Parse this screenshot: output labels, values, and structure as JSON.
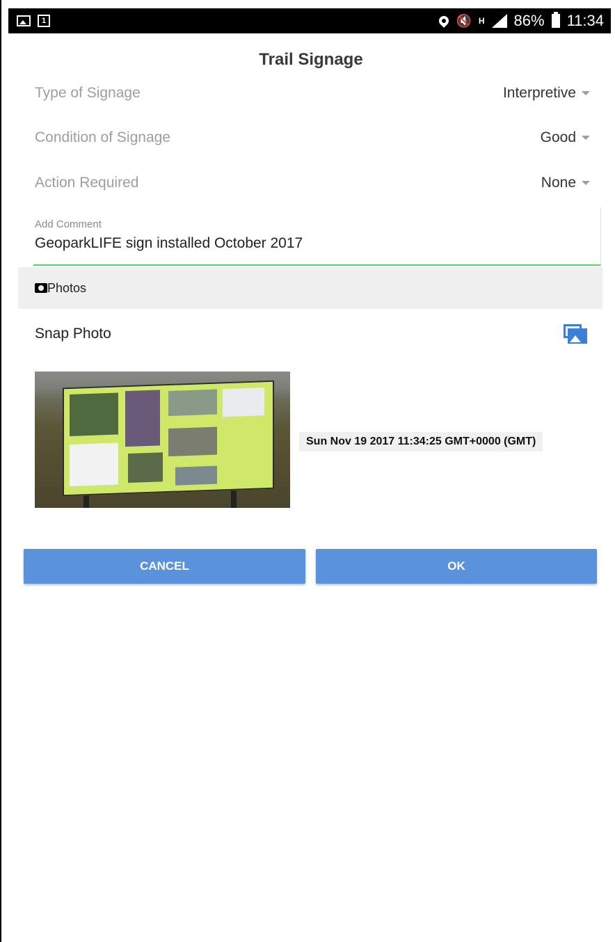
{
  "statusbar": {
    "battery": "86%",
    "time": "11:34",
    "calendar_day": "1",
    "network_badge": "H"
  },
  "form": {
    "title": "Trail Signage",
    "fields": [
      {
        "label": "Type of Signage",
        "value": "Interpretive"
      },
      {
        "label": "Condition of Signage",
        "value": "Good"
      },
      {
        "label": "Action Required",
        "value": "None"
      }
    ],
    "comment": {
      "label": "Add Comment",
      "value": "GeoparkLIFE sign installed October 2017"
    }
  },
  "photos": {
    "section_label": "Photos",
    "snap_label": "Snap Photo",
    "timestamp": "Sun Nov 19 2017 11:34:25 GMT+0000 (GMT)"
  },
  "actions": {
    "cancel_label": "CANCEL",
    "ok_label": "OK"
  },
  "colors": {
    "accent_green": "#4cd964",
    "button_blue": "#5a92db",
    "icon_blue": "#3b80d6"
  }
}
